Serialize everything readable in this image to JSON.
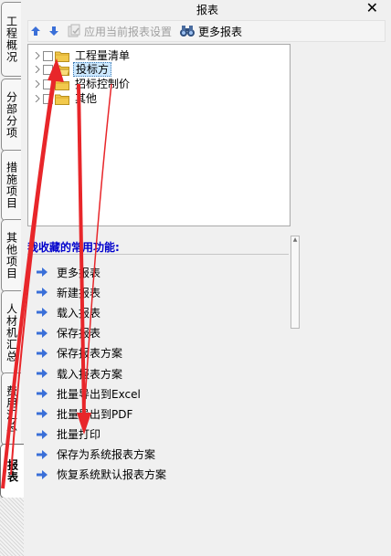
{
  "side_tabs": [
    {
      "label": "工程概况",
      "active": false
    },
    {
      "label": "分部分项",
      "active": false
    },
    {
      "label": "措施项目",
      "active": false
    },
    {
      "label": "其他项目",
      "active": false
    },
    {
      "label": "人材机汇总",
      "active": false
    },
    {
      "label": "费用汇总",
      "active": false
    },
    {
      "label": "报表",
      "active": true
    }
  ],
  "panel": {
    "title": "报表",
    "close_glyph": "✕"
  },
  "toolbar": {
    "move_up_icon": "arrow-up-icon",
    "move_down_icon": "arrow-down-icon",
    "apply_settings_label": "应用当前报表设置",
    "more_reports_label": "更多报表"
  },
  "tree": {
    "items": [
      {
        "label": "工程量清单",
        "selected": false
      },
      {
        "label": "投标方",
        "selected": true
      },
      {
        "label": "招标控制价",
        "selected": false
      },
      {
        "label": "其他",
        "selected": false
      }
    ]
  },
  "favorites": {
    "header": "我收藏的常用功能:",
    "items": [
      "更多报表",
      "新建报表",
      "载入报表",
      "保存报表",
      "保存报表方案",
      "载入报表方案",
      "批量导出到Excel",
      "批量导出到PDF",
      "批量打印",
      "保存为系统报表方案",
      "恢复系统默认报表方案"
    ]
  },
  "colors": {
    "accent_link": "#0000cc",
    "annotation": "#e8262a",
    "folder": "#f2c94c",
    "arrow_icon": "#3a6fd8"
  }
}
